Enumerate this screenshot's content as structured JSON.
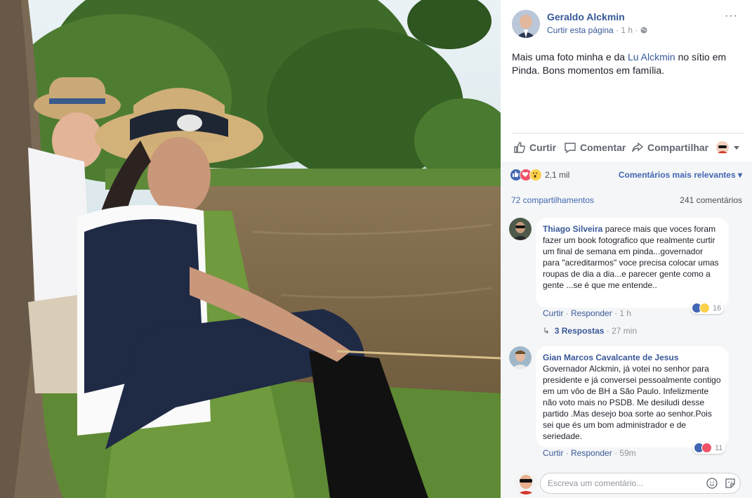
{
  "post": {
    "author": "Geraldo Alckmin",
    "like_page": "Curtir esta página",
    "meta_sep": " · ",
    "time": "1 h",
    "meta_end": " · ",
    "text_before": "Mais uma foto minha e da ",
    "mention": "Lu Alckmin",
    "text_after": " no sítio em Pinda. Bons momentos em família.",
    "more": "···"
  },
  "actions": {
    "like": "Curtir",
    "comment": "Comentar",
    "share": "Compartilhar"
  },
  "reactions": {
    "count": "2,1 mil",
    "sort": "Comentários mais relevantes",
    "shares": "72 compartilhamentos",
    "comments": "241 comentários"
  },
  "comments": [
    {
      "name": "Thiago Silveira",
      "text": " parece mais que voces foram fazer um book fotografico que realmente curtir um final de semana em pinda...governador para \"acreditarmos\" voce precisa colocar umas roupas de dia a dia...e parecer gente como a gente ...se é que me entende..",
      "reactions": "16",
      "like": "Curtir",
      "reply": "Responder",
      "time": "1 h",
      "replies": "3 Respostas",
      "replies_time": "27 min"
    },
    {
      "name": "Gian Marcos Cavalcante de Jesus",
      "text": "Governador Alckmin, já votei no senhor para presidente e já conversei pessoalmente contigo em um vôo de BH a São Paulo. Infelizmente não voto mais no PSDB. Me desiludi desse partido .Mas desejo boa sorte ao senhor.Pois sei que és um bom administrador e de seriedade.",
      "reactions": "11",
      "like": "Curtir",
      "reply": "Responder",
      "time": "59m"
    }
  ],
  "compose": {
    "placeholder": "Escreva um comentário..."
  },
  "colors": {
    "link": "#365899",
    "like_blue": "#4267b2",
    "love_red": "#f25268",
    "wow_yellow": "#fbd14b"
  }
}
